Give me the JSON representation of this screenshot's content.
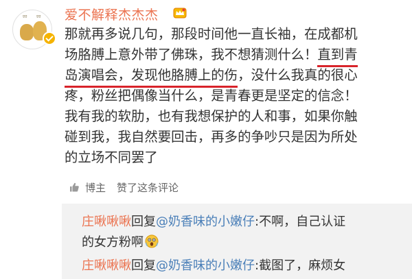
{
  "post": {
    "username": "爱不解释杰杰杰",
    "body_lines": [
      [
        "那就再多说几句，那段时间他一直长袖，在成都机"
      ],
      [
        "场胳膊上意外带了佛珠，我不想猜测什么！",
        "直到青"
      ],
      [
        "岛演唱会，发现他胳膊上的伤",
        "，没什么我真的很心"
      ],
      [
        "疼，粉丝把偶像当什么，是青春更是坚定的信念！"
      ],
      [
        "我有我的软肋，也有我想保护的人和事，如果你触"
      ],
      [
        "碰到我，我自然要回击，再多的争吵只是因为所处"
      ],
      [
        "的立场不同罢了"
      ]
    ],
    "meta": {
      "role": "博主",
      "action": "赞了这条评论"
    }
  },
  "replies": [
    {
      "author": "庄啾啾啾",
      "verb": "回复",
      "target": "@奶香味的小嫩仔",
      "text_line1": ":不啊，自己认证",
      "text_line2": "的女方粉啊"
    },
    {
      "author": "庄啾啾啾",
      "verb": "回复",
      "target": "@奶香味的小嫩仔",
      "text_line1": ":截图了，麻烦女"
    }
  ],
  "colors": {
    "accent": "#eb7350",
    "link": "#4a7fb8",
    "underline": "#d8232a",
    "reply_bg": "#f2f2f2"
  }
}
